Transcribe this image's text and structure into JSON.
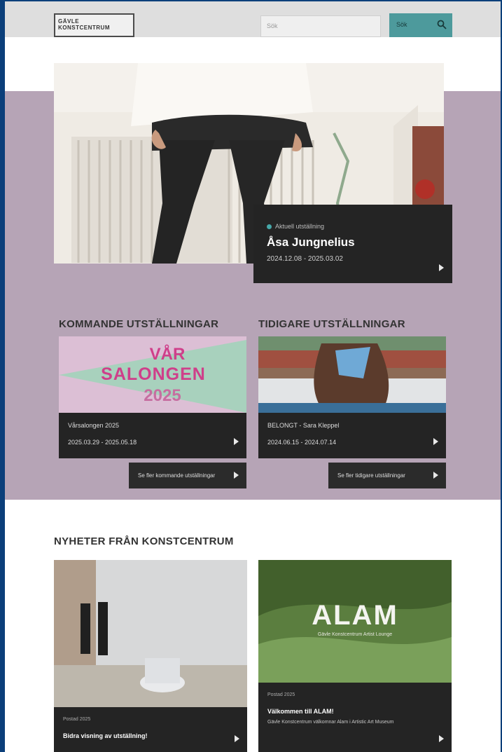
{
  "header": {
    "logo_line1": "GÄVLE",
    "logo_line2": "KONSTCENTRUM",
    "search_placeholder": "Sök",
    "search_button": "Sök"
  },
  "hero": {
    "tag": "Aktuell utställning",
    "title": "Åsa Jungnelius",
    "dates": "2024.12.08 - 2025.03.02"
  },
  "upcoming": {
    "heading": "KOMMANDE UTSTÄLLNINGAR",
    "poster_line1": "VÅR",
    "poster_line2": "SALONGEN",
    "poster_line3": "2025",
    "title": "Vårsalongen 2025",
    "dates": "2025.03.29 - 2025.05.18",
    "more_button": "Se fler kommande utställningar"
  },
  "previous": {
    "heading": "TIDIGARE UTSTÄLLNINGAR",
    "title": "BELONGT - Sara Kleppel",
    "dates": "2024.06.15 - 2024.07.14",
    "more_button": "Se fler tidigare utställningar"
  },
  "news": {
    "heading": "NYHETER FRÅN KONSTCENTRUM",
    "items": [
      {
        "date": "Postad 2025",
        "title": "Bidra visning av utställning!"
      },
      {
        "image_text": "ALAM",
        "image_subtext": "Gävle Konstcentrum Artist Lounge",
        "date": "Postad 2025",
        "title": "Välkommen till ALAM!",
        "body": "Gävle Konstcentrum välkomnar Alam i Artistic Art Museum"
      }
    ]
  },
  "colors": {
    "purple_band": "#b6a4b6",
    "card_dark": "#242424",
    "accent_teal": "#4d9a9c",
    "frame_blue": "#0b3f7a"
  }
}
